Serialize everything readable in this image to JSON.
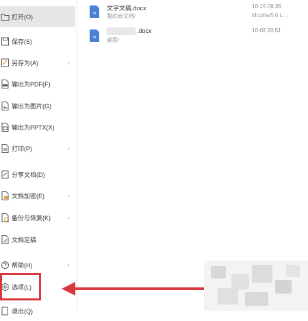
{
  "menu": {
    "items": [
      {
        "label": "打开(O)",
        "icon": "folder-icon"
      },
      {
        "label": "保存(S)",
        "icon": "save-icon"
      },
      {
        "label": "另存为(A)",
        "icon": "save-as-icon"
      },
      {
        "label": "输出为PDF(F)",
        "icon": "pdf-icon"
      },
      {
        "label": "输出为图片(G)",
        "icon": "image-icon"
      },
      {
        "label": "输出为PPTX(X)",
        "icon": "pptx-icon"
      },
      {
        "label": "打印(P)",
        "icon": "print-icon"
      },
      {
        "label": "分享文档(D)",
        "icon": "share-icon"
      },
      {
        "label": "文档加密(E)",
        "icon": "lock-icon"
      },
      {
        "label": "备份与恢复(K)",
        "icon": "backup-icon"
      },
      {
        "label": "文档定稿",
        "icon": "finalize-icon"
      },
      {
        "label": "帮助(H)",
        "icon": "help-icon"
      },
      {
        "label": "选项(L)",
        "icon": "gear-icon"
      },
      {
        "label": "退出(Q)",
        "icon": "exit-icon"
      }
    ],
    "submenu_arrow": "›"
  },
  "recent_files": [
    {
      "name": "文字文稿.docx",
      "path": "我的云文档/",
      "time": "10-15 09:36",
      "source": "Mozilla/5.0 L..."
    },
    {
      "name": ".docx",
      "path": "桌面/",
      "time": "10-02 20:51",
      "source": ""
    }
  ],
  "colors": {
    "highlight": "#d9363e",
    "active_bg": "#e6e6e6",
    "doc_blue": "#4a7fd4"
  }
}
